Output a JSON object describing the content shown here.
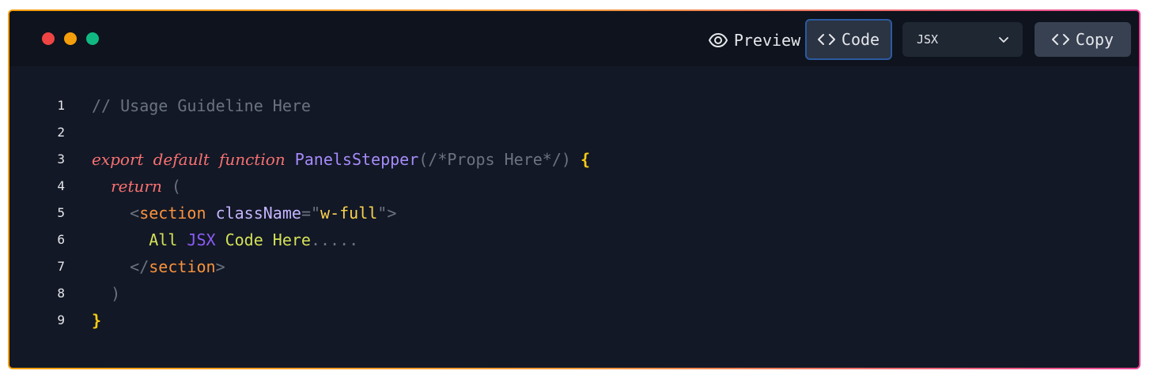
{
  "toolbar": {
    "preview_label": "Preview",
    "code_label": "Code",
    "language_selected": "JSX",
    "copy_label": "Copy"
  },
  "code": {
    "line_numbers": [
      "1",
      "2",
      "3",
      "4",
      "5",
      "6",
      "7",
      "8",
      "9"
    ],
    "line1_comment": "// Usage Guideline Here",
    "line3_kw_export": "export",
    "line3_kw_default": "default",
    "line3_kw_function": "function",
    "line3_fn_name": "PanelsStepper",
    "line3_params": "(/*Props Here*/)",
    "line3_brace": "{",
    "line4_kw_return": "return",
    "line4_paren": "(",
    "line5_lt": "<",
    "line5_tag": "section",
    "line5_attr": "className",
    "line5_eq": "=",
    "line5_q1": "\"",
    "line5_str": "w-full",
    "line5_q2": "\"",
    "line5_gt": ">",
    "line6_text_all": "All",
    "line6_text_jsx": "JSX",
    "line6_text_rest": "Code Here",
    "line6_dots": ".....",
    "line7_open": "</",
    "line7_tag": "section",
    "line7_gt": ">",
    "line8_paren": ")",
    "line9_brace": "}"
  }
}
